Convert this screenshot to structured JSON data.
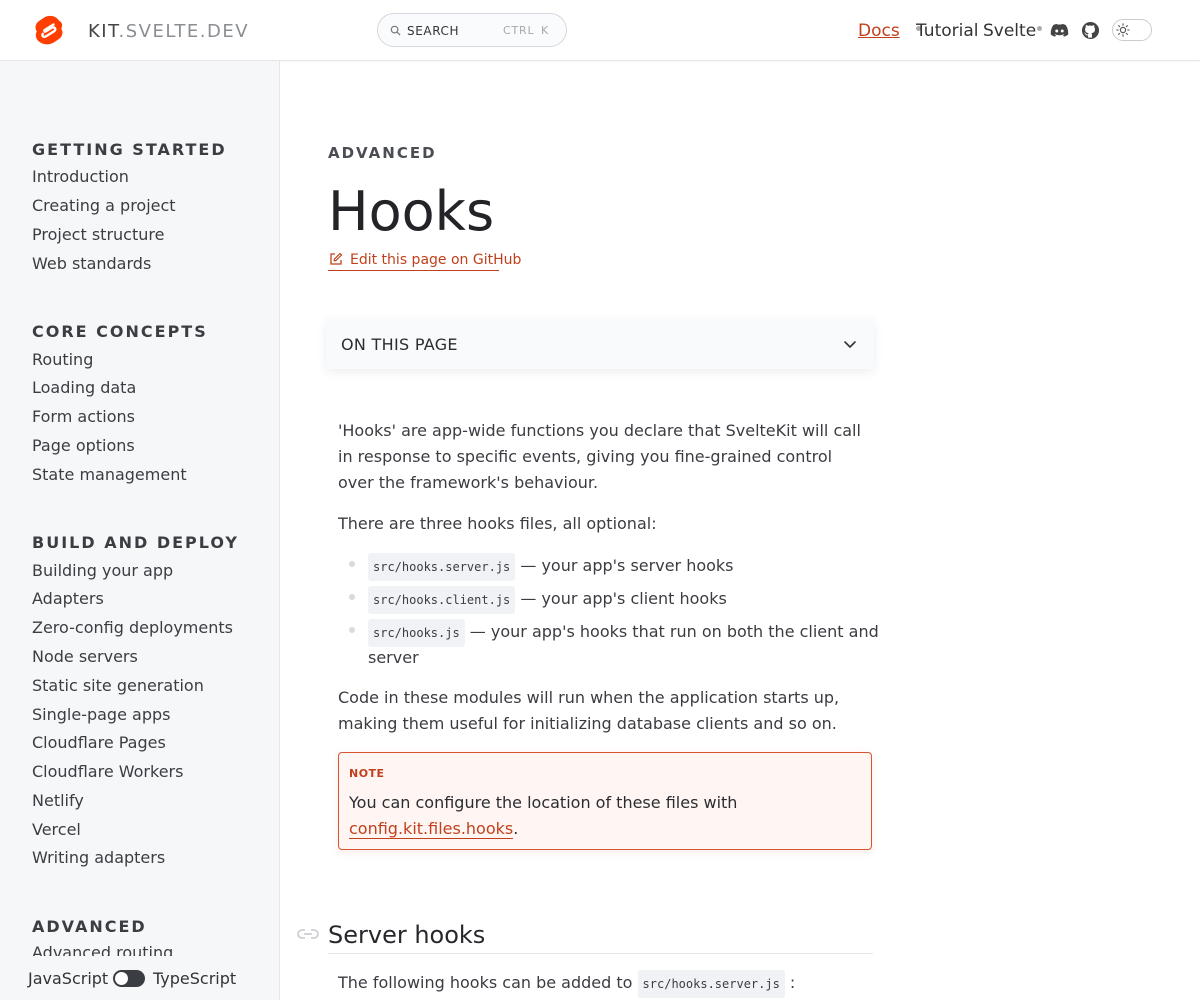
{
  "header": {
    "brand_main": "KIT",
    "brand_rest": ".SVELTE.DEV",
    "search_label": "SEARCH",
    "search_kbd_1": "CTRL",
    "search_kbd_2": "K",
    "nav_docs": "Docs",
    "nav_tutorial": "Tutorial",
    "nav_svelte": "Svelte",
    "icons": [
      "svelte-logo",
      "search-icon",
      "discord-icon",
      "github-icon",
      "sun-icon"
    ],
    "accent_color": "#c1401b",
    "logo_color": "#ff3e00"
  },
  "sidebar": {
    "sections": [
      {
        "heading": "GETTING STARTED",
        "items": [
          "Introduction",
          "Creating a project",
          "Project structure",
          "Web standards"
        ]
      },
      {
        "heading": "CORE CONCEPTS",
        "items": [
          "Routing",
          "Loading data",
          "Form actions",
          "Page options",
          "State management"
        ]
      },
      {
        "heading": "BUILD AND DEPLOY",
        "items": [
          "Building your app",
          "Adapters",
          "Zero-config deployments",
          "Node servers",
          "Static site generation",
          "Single-page apps",
          "Cloudflare Pages",
          "Cloudflare Workers",
          "Netlify",
          "Vercel",
          "Writing adapters"
        ]
      },
      {
        "heading": "ADVANCED",
        "items": [
          "Advanced routing"
        ]
      }
    ],
    "lang_js": "JavaScript",
    "lang_ts": "TypeScript"
  },
  "main": {
    "eyebrow": "ADVANCED",
    "title": "Hooks",
    "edit_link": "Edit this page on GitHub",
    "on_this_page": "ON THIS PAGE",
    "intro": "'Hooks' are app-wide functions you declare that SvelteKit will call in response to specific events, giving you fine-grained control over the framework's behaviour.",
    "files_intro": "There are three hooks files, all optional:",
    "files": [
      {
        "code": "src/hooks.server.js",
        "text": "— your app's server hooks"
      },
      {
        "code": "src/hooks.client.js",
        "text": "— your app's client hooks"
      },
      {
        "code": "src/hooks.js",
        "text": "— your app's hooks that run on both the client and",
        "text_cont": "server"
      }
    ],
    "modules_para": "Code in these modules will run when the application starts up, making them useful for initializing database clients and so on.",
    "note": {
      "tag": "NOTE",
      "text": "You can configure the location of these files with",
      "link": "config.kit.files.hooks",
      "suffix": "."
    },
    "server_hooks_heading": "Server hooks",
    "server_hooks_intro": "The following hooks can be added to",
    "server_hooks_code": "src/hooks.server.js",
    "server_hooks_suffix": ":"
  }
}
